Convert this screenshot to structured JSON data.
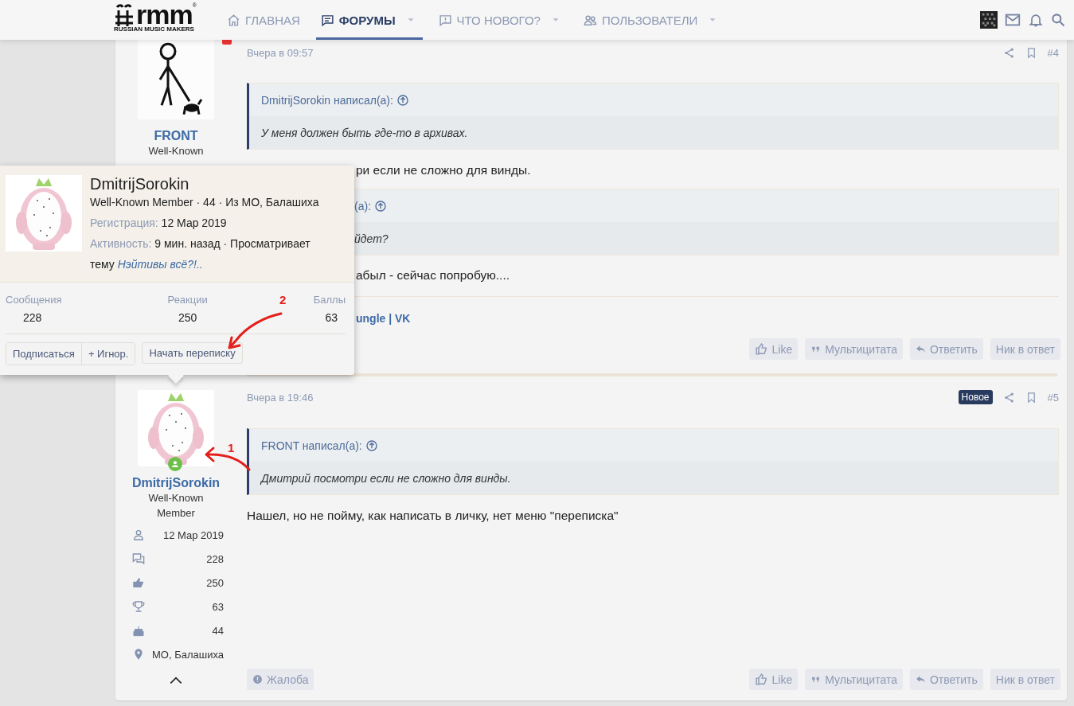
{
  "header": {
    "logo": "rmm",
    "logo_mark": "®",
    "logo_tagline": "RUSSIAN MUSIC MAKERS",
    "nav": [
      {
        "label": "ГЛАВНАЯ",
        "selected": false,
        "dropdown": false
      },
      {
        "label": "ФОРУМЫ",
        "selected": true,
        "dropdown": true
      },
      {
        "label": "ЧТО НОВОГО?",
        "selected": false,
        "dropdown": true
      },
      {
        "label": "ПОЛЬЗОВАТЕЛИ",
        "selected": false,
        "dropdown": true
      }
    ]
  },
  "posts": [
    {
      "number": "#4",
      "time": "Вчера в 09:57",
      "author": {
        "name": "FRONT",
        "title": "Well-Known",
        "online": false
      },
      "blocks": [
        {
          "kind": "quote",
          "author": "DmitrijSorokin написал(а):",
          "text": "У меня должен быть где-то в архивах."
        },
        {
          "kind": "text",
          "text": "ри если не сложно для винды.",
          "covered": true
        },
        {
          "kind": "quote",
          "author": "(а):",
          "text": "йдет?",
          "covered": true
        },
        {
          "kind": "text",
          "text": "абыл - сейчас попробую....",
          "covered": true
        }
      ],
      "signature": {
        "text": "ungle | VK",
        "covered": true
      },
      "actions": [
        {
          "kind": "like",
          "label": "Like"
        },
        {
          "kind": "quote",
          "label": "Мультицитата"
        },
        {
          "kind": "reply",
          "label": "Ответить"
        },
        {
          "kind": "mention",
          "label": "Ник в ответ"
        }
      ]
    },
    {
      "number": "#5",
      "time": "Вчера в 19:46",
      "badge": "Новое",
      "author": {
        "name": "DmitrijSorokin",
        "title": "Well-Known Member",
        "online": true,
        "stats": [
          {
            "kind": "joined",
            "value": "12 Мар 2019"
          },
          {
            "kind": "messages",
            "value": "228"
          },
          {
            "kind": "reactions",
            "value": "250"
          },
          {
            "kind": "points",
            "value": "63"
          },
          {
            "kind": "age",
            "value": "44"
          },
          {
            "kind": "location",
            "value": "МО, Балашиха"
          }
        ]
      },
      "blocks": [
        {
          "kind": "quote",
          "author": "FRONT написал(а):",
          "text": "Дмитрий посмотри если не сложно для винды."
        },
        {
          "kind": "text",
          "text": "Нашел, но не пойму, как написать в личку, нет меню \"переписка\""
        }
      ],
      "report": "Жалоба",
      "actions": [
        {
          "kind": "like",
          "label": "Like"
        },
        {
          "kind": "quote",
          "label": "Мультицитата"
        },
        {
          "kind": "reply",
          "label": "Ответить"
        },
        {
          "kind": "mention",
          "label": "Ник в ответ"
        }
      ]
    }
  ],
  "popup": {
    "name": "DmitrijSorokin",
    "summary": "Well-Known Member · 44 · Из МО, Балашиха",
    "registration_label": "Регистрация:",
    "registration": "12 Мар 2019",
    "activity_label": "Активность:",
    "activity": "9 мин. назад · Просматривает тему",
    "activity_link": "Нэйтивы всё?!..",
    "stats": [
      {
        "label": "Сообщения",
        "value": "228"
      },
      {
        "label": "Реакции",
        "value": "250"
      },
      {
        "label": "Баллы",
        "value": "63"
      }
    ],
    "buttons": [
      "Подписаться",
      "+ Игнор.",
      "Начать переписку"
    ]
  },
  "annotations": [
    {
      "label": "2"
    },
    {
      "label": "1"
    }
  ]
}
